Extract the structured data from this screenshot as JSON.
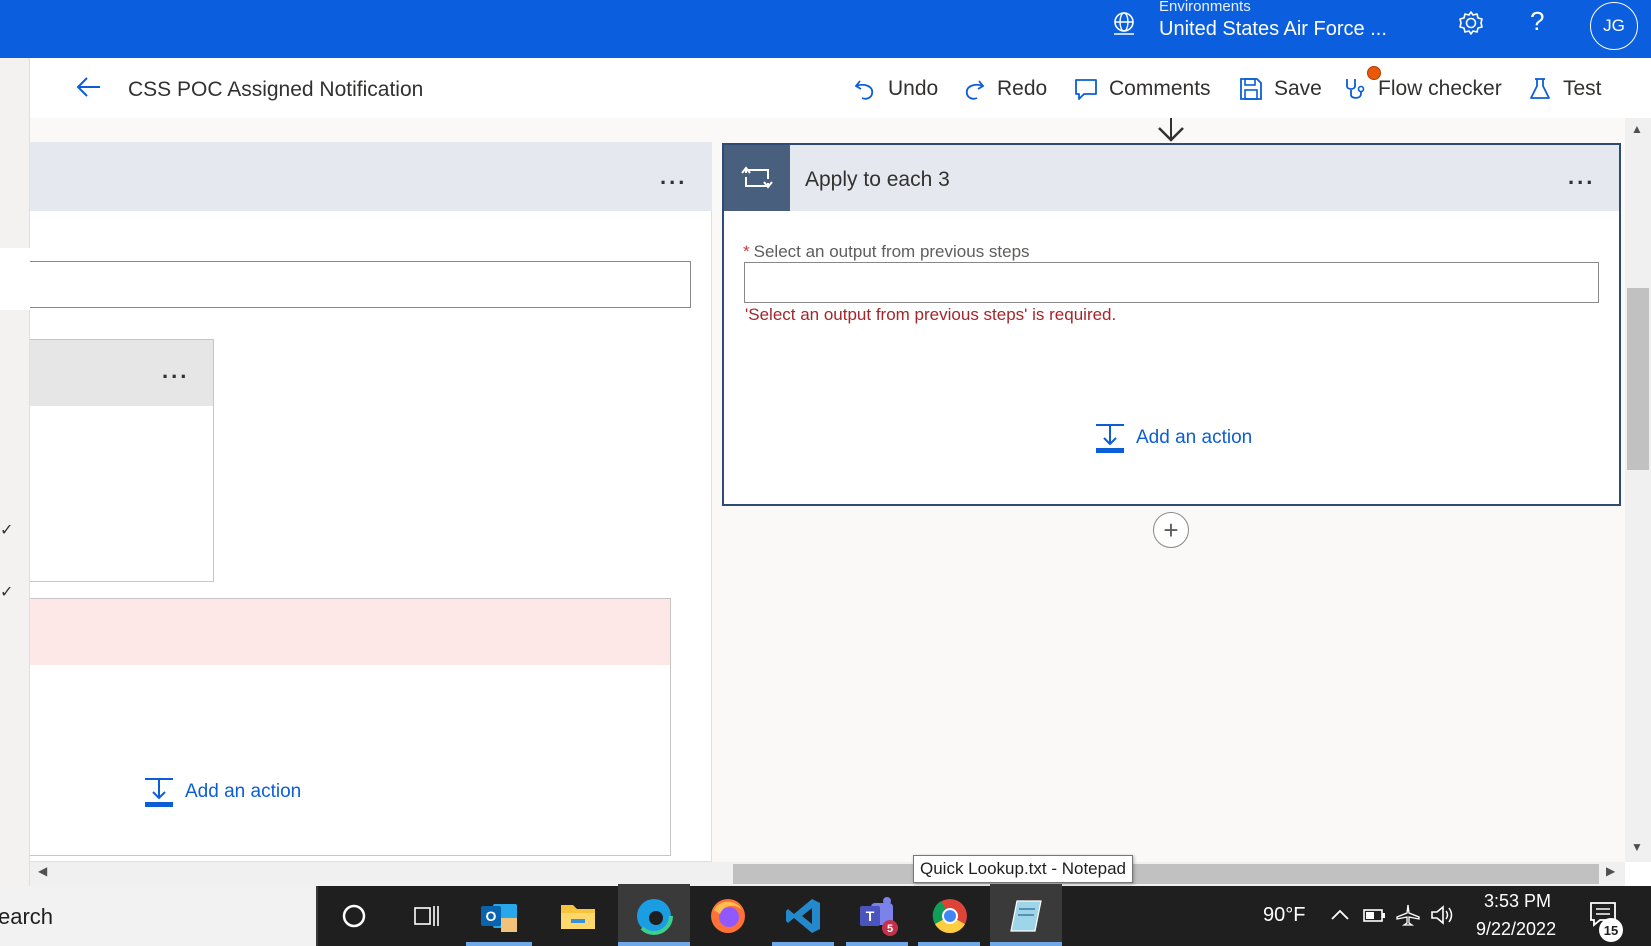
{
  "header": {
    "env_label": "Environments",
    "env_name": "United States Air Force ...",
    "avatar_initials": "JG",
    "help_glyph": "?"
  },
  "commandbar": {
    "flow_title": "CSS POC Assigned Notification",
    "undo": "Undo",
    "redo": "Redo",
    "comments": "Comments",
    "save": "Save",
    "flow_checker": "Flow checker",
    "test": "Test"
  },
  "left_panel": {
    "more_glyph": "...",
    "add_action": "Add an action",
    "check_glyph": "✓"
  },
  "apply_card": {
    "title": "Apply to each 3",
    "more_glyph": "...",
    "field_label": "Select an output from previous steps",
    "required_mark": "*",
    "input_value": "",
    "error": "'Select an output from previous steps' is required.",
    "add_action": "Add an action",
    "insert_glyph": "+"
  },
  "tooltip": "Quick Lookup.txt - Notepad",
  "taskbar": {
    "search_text": "earch",
    "temperature": "90°F",
    "time": "3:53 PM",
    "date": "9/22/2022",
    "teams_badge": "5",
    "notification_count": "15"
  },
  "colors": {
    "topbar": "#0b5ede",
    "card_header": "#e5e9ef",
    "card_border": "#2f4a74",
    "error": "#a4262c",
    "link": "#0b5ed7",
    "flow_checker_dot": "#e8590c"
  },
  "icons": [
    "back-arrow-icon",
    "undo-icon",
    "redo-icon",
    "comment-icon",
    "save-icon",
    "stethoscope-icon",
    "flask-icon",
    "globe-icon",
    "gear-icon",
    "loop-icon",
    "add-action-icon",
    "chevron-down-icon"
  ]
}
